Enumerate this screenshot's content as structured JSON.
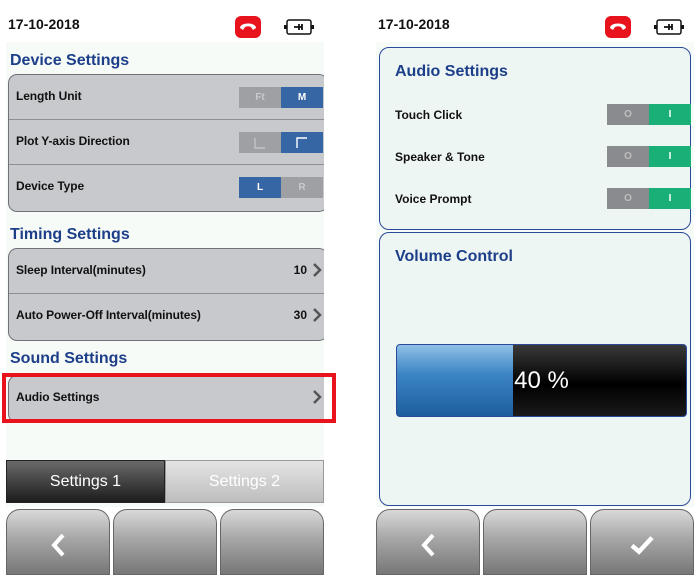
{
  "left_screen": {
    "date": "17-10-2018",
    "sections": {
      "device": {
        "title": "Device Settings",
        "rows": [
          {
            "label": "Length Unit",
            "toggle": [
              "Ft",
              "M"
            ]
          },
          {
            "label": "Plot Y-axis Direction",
            "toggle": [
              "",
              ""
            ]
          },
          {
            "label": "Device Type",
            "toggle": [
              "L",
              "R"
            ]
          }
        ]
      },
      "timing": {
        "title": "Timing Settings",
        "rows": [
          {
            "label": "Sleep Interval(minutes)",
            "value": "10"
          },
          {
            "label": "Auto Power-Off Interval(minutes)",
            "value": "30"
          }
        ]
      },
      "sound": {
        "title": "Sound Settings",
        "rows": [
          {
            "label": "Audio Settings"
          }
        ]
      }
    },
    "tabs": [
      "Settings 1",
      "Settings 2"
    ],
    "active_tab": "Settings 1"
  },
  "right_screen": {
    "date": "17-10-2018",
    "audio": {
      "title": "Audio Settings",
      "rows": [
        {
          "label": "Touch Click",
          "off": "O",
          "on": "I",
          "state": "on"
        },
        {
          "label": "Speaker & Tone",
          "off": "O",
          "on": "I",
          "state": "on"
        },
        {
          "label": "Voice Prompt",
          "off": "O",
          "on": "I",
          "state": "on"
        }
      ]
    },
    "volume": {
      "title": "Volume Control",
      "level": 40,
      "display": "40 %"
    }
  },
  "icons": {
    "status_phone": "phone-hangup-icon",
    "status_power": "power-plug-icon",
    "nav_back": "chevron-left-icon",
    "nav_confirm": "checkmark-icon",
    "row_next": "chevron-right-icon"
  },
  "colors": {
    "accent_blue": "#3766a5",
    "title_blue": "#1d3f8a",
    "alert_red": "#e8131d",
    "toggle_green": "#1aaf77"
  }
}
